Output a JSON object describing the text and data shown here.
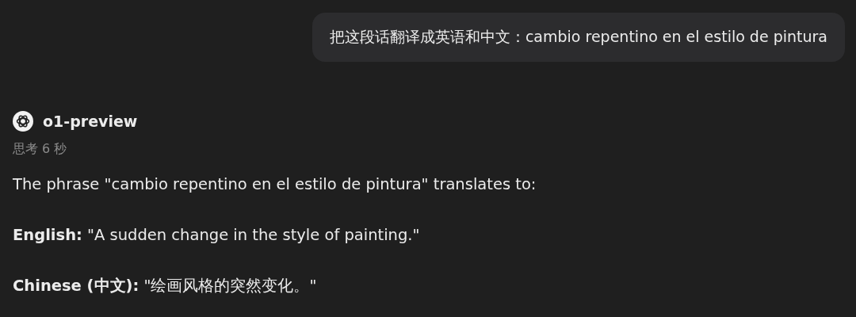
{
  "user_message": {
    "text": "把这段话翻译成英语和中文：cambio repentino en el estilo de pintura"
  },
  "response": {
    "model": "o1-preview",
    "thinking_time": "思考 6 秒",
    "paragraphs": [
      "The phrase \"cambio repentino en el estilo de pintura\" translates to:",
      "**English:** \"A sudden change in the style of painting.\"",
      "**Chinese (中文):** \"绘画风格的突然变化。\""
    ]
  }
}
